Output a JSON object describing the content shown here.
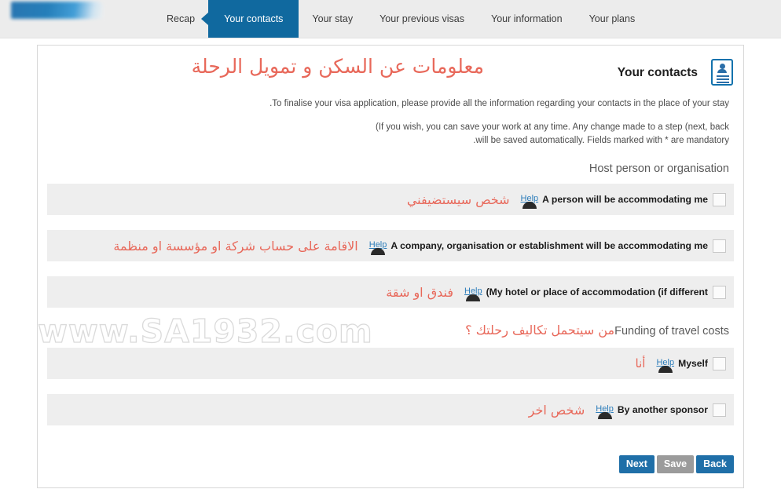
{
  "nav": {
    "logo_name": "site-logo",
    "tabs": [
      {
        "label": "Recap",
        "active": false
      },
      {
        "label": "Your contacts",
        "active": true
      },
      {
        "label": "Your stay",
        "active": false
      },
      {
        "label": "Your previous visas",
        "active": false
      },
      {
        "label": "Your information",
        "active": false
      },
      {
        "label": "Your plans",
        "active": false
      }
    ]
  },
  "header": {
    "title_ar": "معلومات عن السكن و تمويل الرحلة",
    "title_en": "Your contacts",
    "icon": "contact-card-icon"
  },
  "intro": {
    "line1": ".To finalise your visa application, please provide all the information regarding your contacts in the place of your stay",
    "line2a": "(If you wish, you can save your work at any time. Any change made to a step (next, back",
    "line2b": ".will be saved automatically. Fields marked with * are mandatory"
  },
  "sections": [
    {
      "id": "host-person-or-organisation",
      "heading_en": "Host person or organisation",
      "heading_ar": "",
      "options": [
        {
          "id": "a-person-will-be-accommodating-me",
          "label_en": "A person will be accommodating me",
          "label_ar": "شخص سيستضيفني",
          "help_label": "Help",
          "checked": false
        },
        {
          "id": "a-company-organisation-or-establishment-will-be-accommodating-me",
          "label_en": "A company, organisation or establishment will be accommodating me",
          "label_ar": "الاقامة على حساب شركة او مؤسسة او منظمة",
          "help_label": "Help",
          "checked": false
        },
        {
          "id": "my-hotel-or-place-of-accommodation-if-different",
          "label_en": "(My hotel or place of accommodation (if different",
          "label_ar": "فندق او شقة",
          "help_label": "Help",
          "checked": false
        }
      ]
    },
    {
      "id": "funding-of-travel-costs",
      "heading_en": "Funding of travel costs",
      "heading_ar": "من سيتحمل تكاليف رحلتك ؟",
      "options": [
        {
          "id": "myself",
          "label_en": "Myself",
          "label_ar": "أنا",
          "help_label": "Help",
          "checked": false
        },
        {
          "id": "by-another-sponsor",
          "label_en": "By another sponsor",
          "label_ar": "شخص اخر",
          "help_label": "Help",
          "checked": false
        }
      ]
    }
  ],
  "footer": {
    "next_label": "Next",
    "save_label": "Save",
    "back_label": "Back"
  },
  "watermark": {
    "text": "www.SA1932.com"
  },
  "colors": {
    "nav_active": "#10699f",
    "arabic_red": "#e8685a",
    "help_blue": "#2e7ebb",
    "button_blue": "#1f6fa8",
    "button_gray": "#9b9b9b",
    "row_bg": "#eeeeee"
  }
}
